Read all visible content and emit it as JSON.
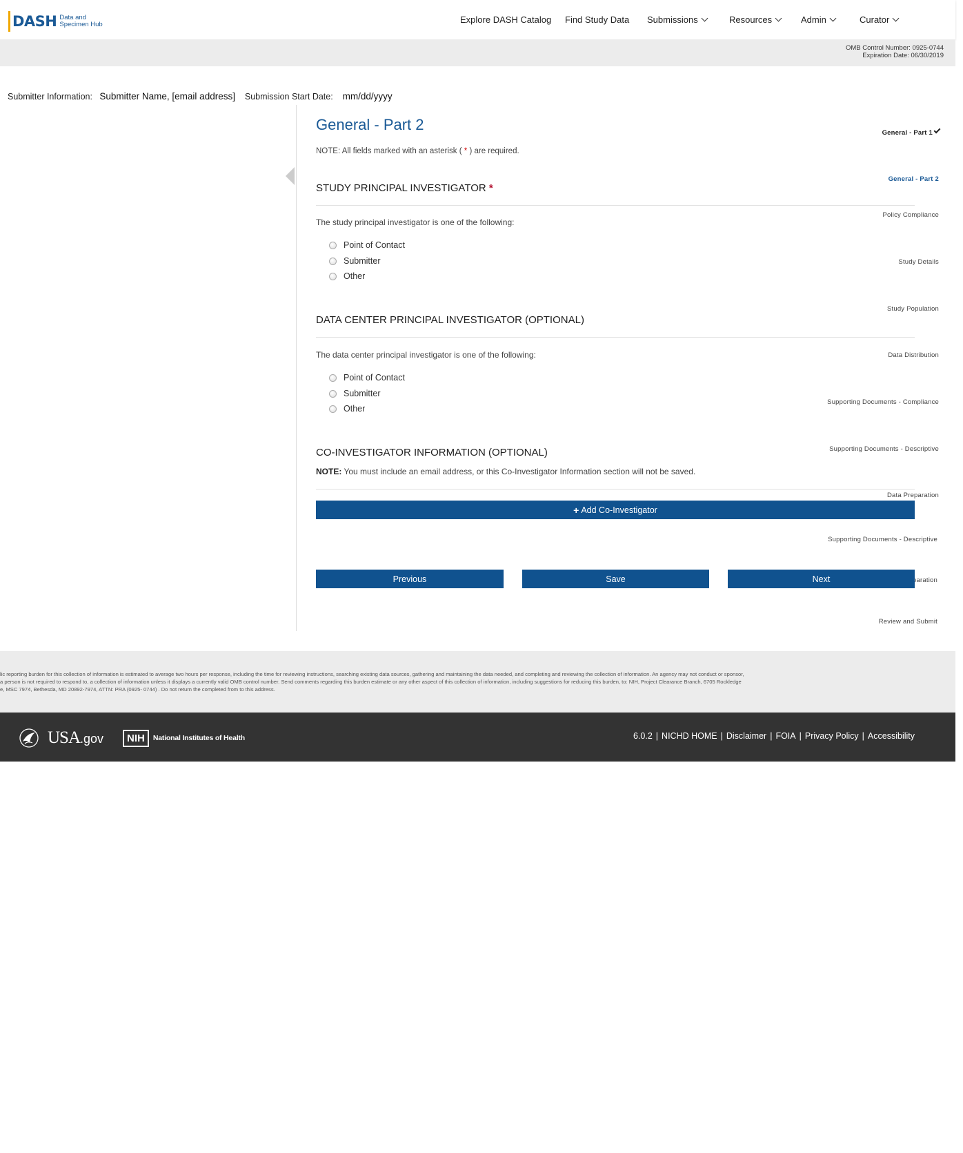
{
  "header": {
    "logo_text": "DASH",
    "logo_sub_line1": "Data and",
    "logo_sub_line2": "Specimen Hub",
    "nav": [
      {
        "label": "Explore DASH Catalog"
      },
      {
        "label": "Find Study Data"
      },
      {
        "label": "Submissions"
      },
      {
        "label": "Resources"
      },
      {
        "label": "Admin"
      },
      {
        "label": "Curator"
      }
    ]
  },
  "omb": {
    "control": "OMB Control Number: 0925-0744",
    "expiration": "Expiration Date: 06/30/2019"
  },
  "submitter": {
    "label": "Submitter Information:",
    "value": "Submitter Name, [email address]",
    "date_label": "Submission Start Date:",
    "date_value": "mm/dd/yyyy"
  },
  "sidebar": {
    "items": [
      {
        "label": "General - Part 1"
      },
      {
        "label": "General - Part 2"
      },
      {
        "label": "Policy Compliance"
      },
      {
        "label": "Study Details"
      },
      {
        "label": "Study Population"
      },
      {
        "label": "Data Distribution"
      },
      {
        "label": "Supporting Documents - Compliance"
      },
      {
        "label": "Supporting Documents - Descriptive"
      },
      {
        "label": "Data Preparation"
      },
      {
        "label": "Supporting Documents - Descriptive"
      },
      {
        "label": "Data Preparation"
      },
      {
        "label": "Review and Submit"
      }
    ]
  },
  "main": {
    "title": "General - Part 2",
    "note_prefix": "NOTE: All fields marked with an asterisk (",
    "note_star": "*",
    "note_suffix": ") are required.",
    "sections": [
      {
        "title": "STUDY PRINCIPAL INVESTIGATOR",
        "required_mark": "*",
        "description": "The study principal investigator is one of the following:",
        "options": [
          "Point of Contact",
          "Submitter",
          "Other"
        ]
      },
      {
        "title": "DATA CENTER PRINCIPAL INVESTIGATOR (OPTIONAL)",
        "description": "The data center principal investigator is one of the following:",
        "options": [
          "Point of Contact",
          "Submitter",
          "Other"
        ]
      }
    ],
    "coinvestigator": {
      "title": "CO-INVESTIGATOR INFORMATION (OPTIONAL)",
      "note_label": "NOTE:",
      "note_text": "You must include an email address, or this Co-Investigator Information section will not be saved.",
      "add_button": "Add Co-Investigator"
    },
    "buttons": {
      "previous": "Previous",
      "save": "Save",
      "next": "Next"
    }
  },
  "footer": {
    "burden_lines": [
      "lic reporting burden for this collection of information is estimated to average two hours per response, including the time for reviewing instructions, searching existing data sources, gathering and maintaining the data needed, and completing and reviewing the collection of information. An agency may not conduct or sponsor,",
      "a person is not required to respond to, a collection of information unless it displays a currently valid OMB control number. Send comments regarding this burden estimate or any other aspect of this collection of information, including suggestions for reducing this burden, to: NIH, Project Clearance Branch, 6705 Rockledge",
      "e, MSC 7974, Bethesda, MD 20892-7974, ATTN: PRA (0925- 0744) . Do not return the completed from to this address."
    ],
    "usagov_main": "USA",
    "usagov_suffix": ".gov",
    "nih": "NIH",
    "nih_text": "National Institutes of Health",
    "links": [
      "6.0.2",
      "NICHD HOME",
      "Disclaimer",
      "FOIA",
      "Privacy Policy",
      "Accessibility"
    ],
    "link_separator": "|"
  }
}
